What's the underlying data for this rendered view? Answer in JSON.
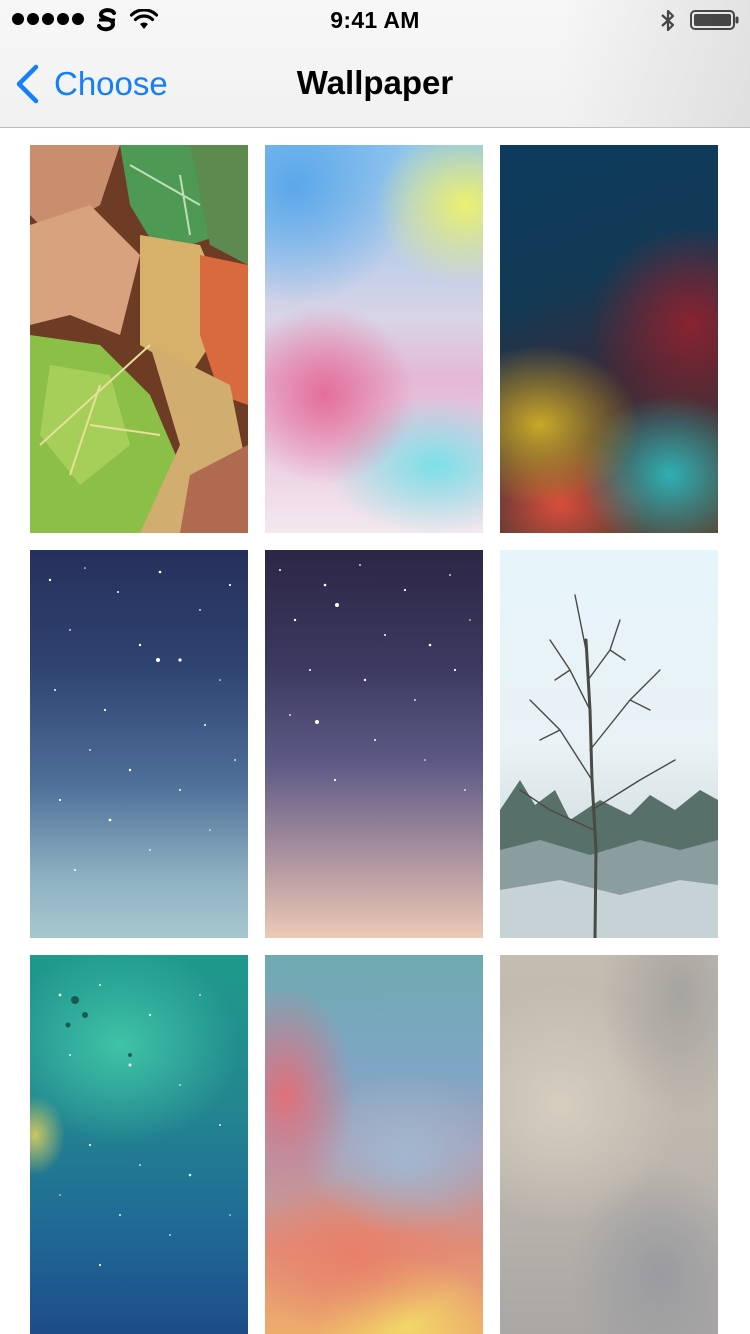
{
  "status_bar": {
    "time": "9:41 AM",
    "signal_icon": "signal-dots-icon",
    "carrier_icon": "carrier-logo-icon",
    "wifi_icon": "wifi-icon",
    "bluetooth_icon": "bluetooth-icon",
    "battery_icon": "battery-full-icon"
  },
  "nav": {
    "back_label": "Choose",
    "back_icon": "chevron-left-icon",
    "title": "Wallpaper",
    "accent_color": "#147efb"
  },
  "wallpapers": [
    {
      "theme": "autumn-leaves"
    },
    {
      "theme": "pastel-gradient"
    },
    {
      "theme": "dark-color-blur"
    },
    {
      "theme": "starry-night-blue"
    },
    {
      "theme": "starry-night-purple"
    },
    {
      "theme": "winter-bare-tree"
    },
    {
      "theme": "teal-space"
    },
    {
      "theme": "rainbow-blur"
    },
    {
      "theme": "gray-blur"
    }
  ]
}
